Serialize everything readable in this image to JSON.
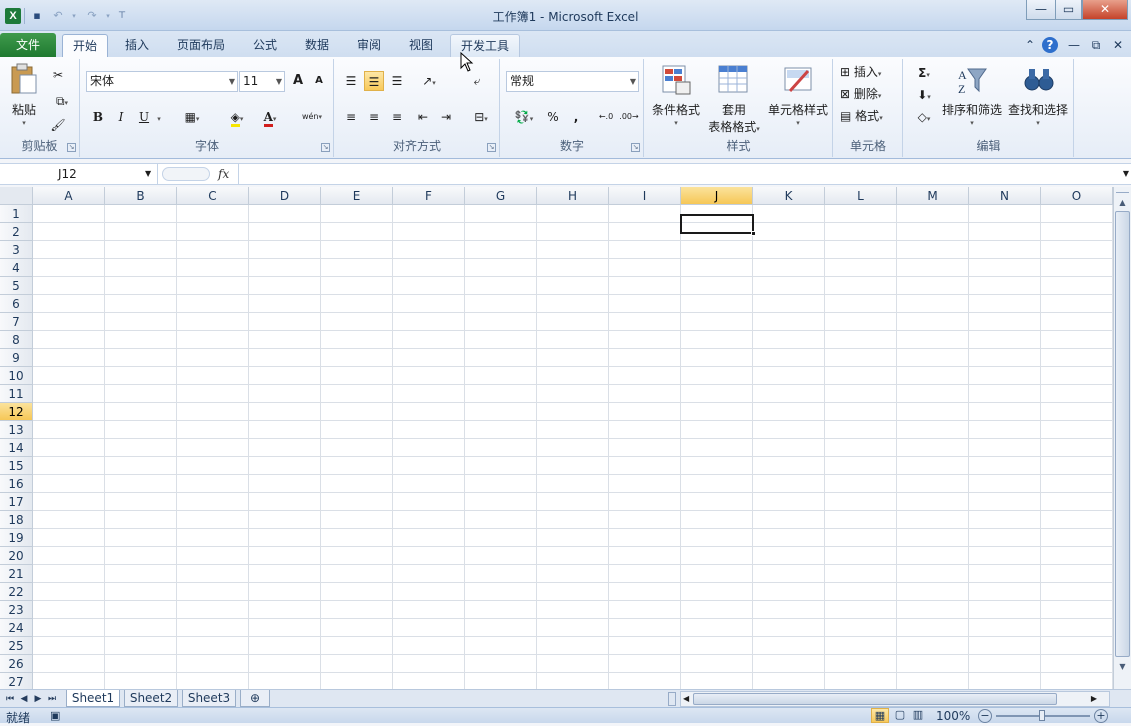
{
  "window": {
    "title": "工作簿1 - Microsoft Excel",
    "app_logo": "X",
    "controls": {
      "minimize": "—",
      "maximize": "▭",
      "close": "✕"
    }
  },
  "quick_access": {
    "save_icon": "💾",
    "undo_icon": "↶",
    "redo_icon": "↷",
    "customize_icon": "▾"
  },
  "tabs": {
    "file": "文件",
    "items": [
      "开始",
      "插入",
      "页面布局",
      "公式",
      "数据",
      "审阅",
      "视图",
      "开发工具"
    ],
    "active": "开始",
    "hovered": "开发工具"
  },
  "ribbon": {
    "clipboard": {
      "label": "剪贴板",
      "paste": "粘贴"
    },
    "font": {
      "label": "字体",
      "name": "宋体",
      "size": "11",
      "bold": "B",
      "italic": "I",
      "underline": "U",
      "grow": "A",
      "shrink": "A",
      "color_letter": "A",
      "phonetic": "wén"
    },
    "alignment": {
      "label": "对齐方式"
    },
    "number": {
      "label": "数字",
      "format": "常规",
      "percent": "%",
      "comma": ","
    },
    "styles": {
      "label": "样式",
      "conditional": "条件格式",
      "table_line1": "套用",
      "table_line2": "表格格式",
      "cell_styles": "单元格样式"
    },
    "cells": {
      "label": "单元格",
      "insert": "插入",
      "delete": "删除",
      "format": "格式"
    },
    "editing": {
      "label": "编辑",
      "sum": "Σ",
      "sort_filter": "排序和筛选",
      "find_select": "查找和选择"
    }
  },
  "formula_bar": {
    "name_box": "J12",
    "fx": "fx",
    "value": ""
  },
  "grid": {
    "columns": [
      "A",
      "B",
      "C",
      "D",
      "E",
      "F",
      "G",
      "H",
      "I",
      "J",
      "K",
      "L",
      "M",
      "N",
      "O"
    ],
    "rows": [
      "1",
      "2",
      "3",
      "4",
      "5",
      "6",
      "7",
      "8",
      "9",
      "10",
      "11",
      "12",
      "13",
      "14",
      "15",
      "16",
      "17",
      "18",
      "19",
      "20",
      "21",
      "22",
      "23",
      "24",
      "25",
      "26",
      "27"
    ],
    "selected_column": "J",
    "selected_row": "12"
  },
  "sheets": {
    "tabs": [
      "Sheet1",
      "Sheet2",
      "Sheet3"
    ],
    "active": "Sheet1"
  },
  "status": {
    "ready": "就绪",
    "zoom": "100%"
  }
}
